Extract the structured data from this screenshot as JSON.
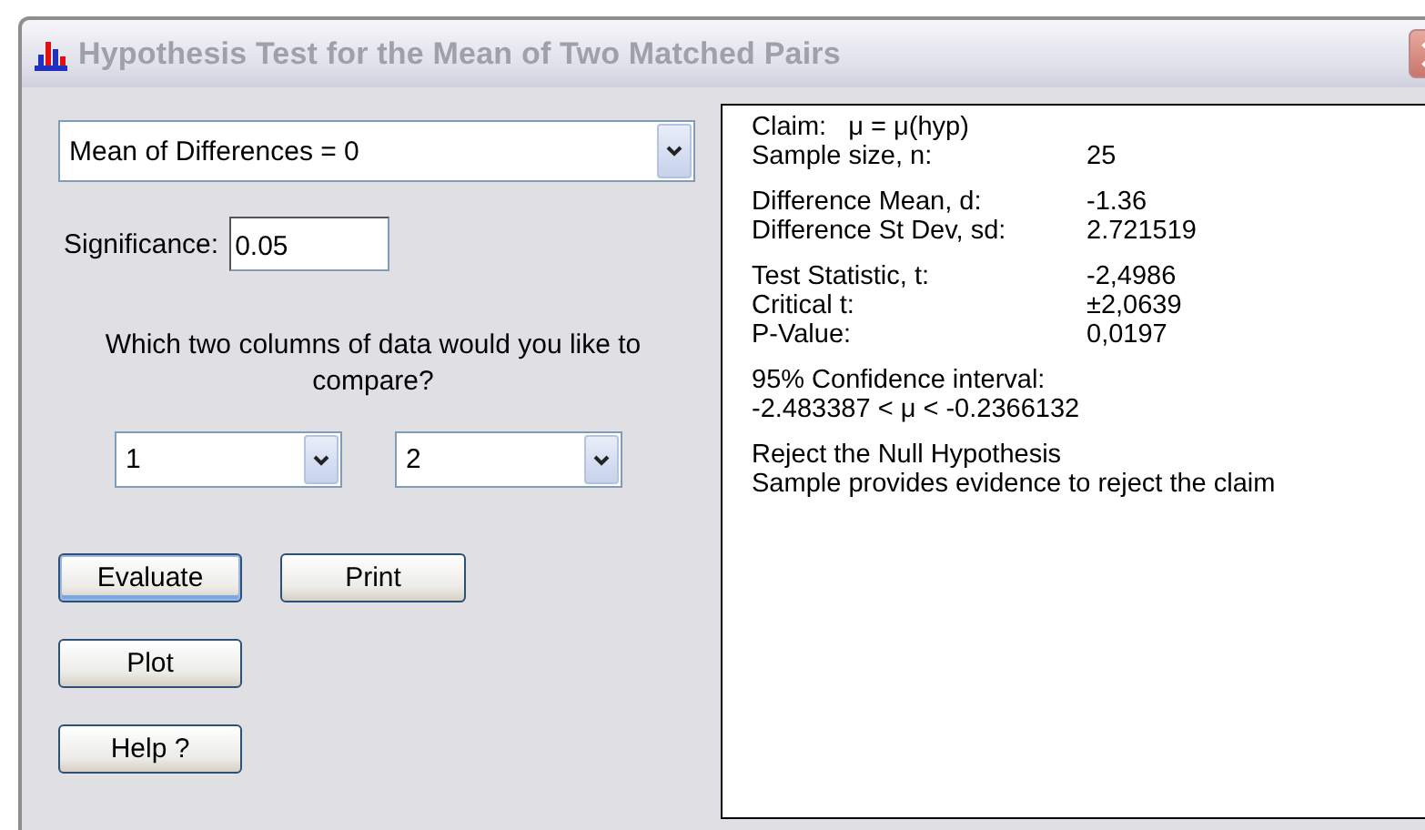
{
  "window": {
    "title": "Hypothesis Test for the Mean of Two Matched Pairs"
  },
  "test_select": {
    "value": "Mean of Differences = 0"
  },
  "significance": {
    "label": "Significance:",
    "value": "0.05"
  },
  "columns_prompt": "Which two columns of data would you like to compare?",
  "column_selects": [
    {
      "value": "1"
    },
    {
      "value": "2"
    }
  ],
  "buttons": [
    {
      "label": "Evaluate",
      "focused": true
    },
    {
      "label": "Print",
      "focused": false
    },
    {
      "label": "Plot",
      "focused": false
    },
    {
      "label": "Help ?",
      "focused": false
    }
  ],
  "results": [
    {
      "lines": [
        {
          "kind": "text",
          "text": "Claim:   μ = μ(hyp)"
        },
        {
          "kind": "pair",
          "label": "Sample size, n:",
          "value": "25"
        }
      ]
    },
    {
      "lines": [
        {
          "kind": "pair",
          "label": "Difference Mean, d:",
          "value": "-1.36"
        },
        {
          "kind": "pair",
          "label": "Difference St Dev, sd:",
          "value": "2.721519"
        }
      ]
    },
    {
      "lines": [
        {
          "kind": "pair",
          "label": "Test Statistic, t:",
          "value": "-2,4986"
        },
        {
          "kind": "pair",
          "label": "Critical t:",
          "value": "±2,0639"
        },
        {
          "kind": "pair",
          "label": "P-Value:",
          "value": "0,0197"
        }
      ]
    },
    {
      "lines": [
        {
          "kind": "text",
          "text": "95% Confidence interval:"
        },
        {
          "kind": "text",
          "text": "-2.483387 < μ < -0.2366132"
        }
      ]
    },
    {
      "lines": [
        {
          "kind": "text",
          "text": "Reject the Null Hypothesis"
        },
        {
          "kind": "text",
          "text": "Sample provides evidence to reject the claim"
        }
      ]
    }
  ]
}
